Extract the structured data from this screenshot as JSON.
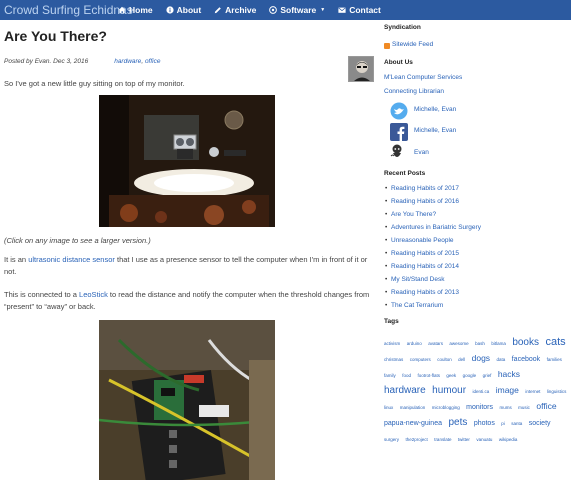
{
  "navbar": {
    "brand": "Crowd Surfing Echidnas",
    "items": [
      {
        "label": "Home",
        "icon": "home-icon"
      },
      {
        "label": "About",
        "icon": "info-icon"
      },
      {
        "label": "Archive",
        "icon": "pencil-icon"
      },
      {
        "label": "Software",
        "icon": "gear-icon"
      },
      {
        "label": "Contact",
        "icon": "envelope-icon"
      }
    ]
  },
  "post": {
    "title": "Are You There?",
    "meta": "Posted by Evan. Dec 3, 2016",
    "categories": [
      "hardware",
      "office"
    ],
    "p1": "So I've got a new little guy sitting on top of my monitor.",
    "caption": "(Click on any image to see a larger version.)",
    "p2_before": "It is an ",
    "p2_link": "ultrasonic distance sensor",
    "p2_after": " that I use as a presence sensor to tell the computer when I'm in front of it or not.",
    "p3_before": "This is connected to a ",
    "p3_link": "LeoStick",
    "p3_after": " to read the distance and notify the computer when the threshold changes from “present” to “away” or back."
  },
  "sidebar": {
    "syndication": {
      "heading": "Syndication",
      "feed": "Sitewide Feed"
    },
    "about": {
      "heading": "About Us",
      "links": [
        "M'Lean Computer Services",
        "Connecting Librarian"
      ],
      "social": [
        {
          "icon": "twitter-icon",
          "label": "Michelle, Evan"
        },
        {
          "icon": "facebook-icon",
          "label": "Michelle, Evan"
        },
        {
          "icon": "github-icon",
          "label": "Evan"
        }
      ]
    },
    "recent": {
      "heading": "Recent Posts",
      "items": [
        "Reading Habits of 2017",
        "Reading Habits of 2016",
        "Are You There?",
        "Adventures in Bariatric Surgery",
        "Unreasonable People",
        "Reading Habits of 2015",
        "Reading Habits of 2014",
        "My Sit/Stand Desk",
        "Reading Habits of 2013",
        "The Cat Terrarium"
      ]
    },
    "tags": {
      "heading": "Tags",
      "items": [
        {
          "t": "activism",
          "s": 1
        },
        {
          "t": "arduino",
          "s": 1
        },
        {
          "t": "avatars",
          "s": 1
        },
        {
          "t": "awesome",
          "s": 1
        },
        {
          "t": "bash",
          "s": 1
        },
        {
          "t": "bitlama",
          "s": 1
        },
        {
          "t": "books",
          "s": 4
        },
        {
          "t": "cats",
          "s": 5
        },
        {
          "t": "christmas",
          "s": 1
        },
        {
          "t": "computers",
          "s": 1
        },
        {
          "t": "coulton",
          "s": 1
        },
        {
          "t": "dell",
          "s": 1
        },
        {
          "t": "dogs",
          "s": 3
        },
        {
          "t": "data",
          "s": 1
        },
        {
          "t": "facebook",
          "s": 2
        },
        {
          "t": "families",
          "s": 1
        },
        {
          "t": "family",
          "s": 1
        },
        {
          "t": "food",
          "s": 1
        },
        {
          "t": "footrot-flats",
          "s": 1
        },
        {
          "t": "geek",
          "s": 1
        },
        {
          "t": "google",
          "s": 1
        },
        {
          "t": "grief",
          "s": 1
        },
        {
          "t": "hacks",
          "s": 3
        },
        {
          "t": "hardware",
          "s": 4
        },
        {
          "t": "humour",
          "s": 4
        },
        {
          "t": "identi.ca",
          "s": 1
        },
        {
          "t": "image",
          "s": 3
        },
        {
          "t": "internet",
          "s": 1
        },
        {
          "t": "linguistics",
          "s": 1
        },
        {
          "t": "linux",
          "s": 1
        },
        {
          "t": "manipulation",
          "s": 1
        },
        {
          "t": "microblogging",
          "s": 1
        },
        {
          "t": "monitors",
          "s": 2
        },
        {
          "t": "mums",
          "s": 1
        },
        {
          "t": "music",
          "s": 1
        },
        {
          "t": "office",
          "s": 3
        },
        {
          "t": "papua-new-guinea",
          "s": 2
        },
        {
          "t": "pets",
          "s": 4
        },
        {
          "t": "photos",
          "s": 2
        },
        {
          "t": "pi",
          "s": 1
        },
        {
          "t": "santa",
          "s": 1
        },
        {
          "t": "society",
          "s": 2
        },
        {
          "t": "surgery",
          "s": 1
        },
        {
          "t": "the2project",
          "s": 1
        },
        {
          "t": "translate",
          "s": 1
        },
        {
          "t": "twitter",
          "s": 1
        },
        {
          "t": "vanuatu",
          "s": 1
        },
        {
          "t": "wikipedia",
          "s": 1
        }
      ]
    }
  }
}
